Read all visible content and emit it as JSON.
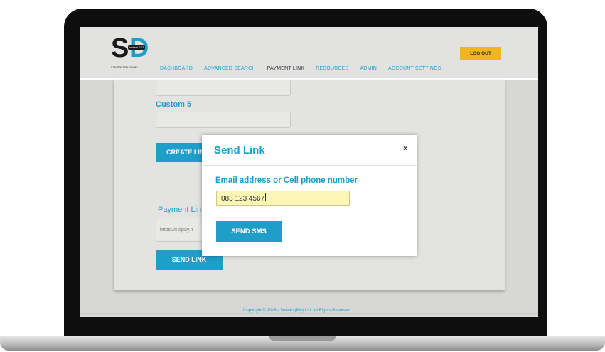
{
  "logo": {
    "letter_s": "S",
    "letter_d": "D",
    "badge": "instant EFT",
    "tagline": "A SmartPay Sicite Company"
  },
  "nav": {
    "items": [
      {
        "label": "DASHBOARD"
      },
      {
        "label": "ADVANCED SEARCH"
      },
      {
        "label": "PAYMENT LINK"
      },
      {
        "label": "RESOURCES"
      },
      {
        "label": "ADMIN"
      },
      {
        "label": "ACCOUNT SETTINGS"
      }
    ],
    "active_index": 2
  },
  "logout_label": "LOG OUT",
  "form": {
    "custom5_label": "Custom 5",
    "create_link_label": "CREATE LINK",
    "payment_link_label": "Payment Link",
    "payment_link_value": "https://sidpay.n",
    "send_link_label": "SEND LINK"
  },
  "footer_text": "Copyright © 2018 - Sekoto (Pty) Ltd. All Rights Reserved",
  "modal": {
    "title": "Send Link",
    "close_symbol": "×",
    "field_label": "Email address or Cell phone number",
    "field_value": "083 123 4567",
    "send_sms_label": "SEND SMS"
  },
  "colors": {
    "accent": "#1e9ec9",
    "logout": "#f2b522",
    "input_highlight": "#fcf6b6"
  }
}
